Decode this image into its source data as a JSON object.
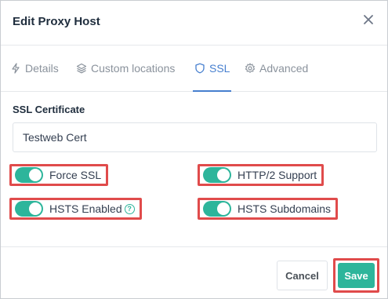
{
  "dialog": {
    "title": "Edit Proxy Host"
  },
  "tabs": [
    {
      "label": "Details",
      "icon": "lightning-icon",
      "active": false
    },
    {
      "label": "Custom locations",
      "icon": "layers-icon",
      "active": false
    },
    {
      "label": "SSL",
      "icon": "shield-icon",
      "active": true
    },
    {
      "label": "Advanced",
      "icon": "gear-icon",
      "active": false
    }
  ],
  "ssl": {
    "certificate_label": "SSL Certificate",
    "certificate_value": "Testweb Cert",
    "toggles": {
      "force_ssl": {
        "label": "Force SSL",
        "on": true
      },
      "http2": {
        "label": "HTTP/2 Support",
        "on": true
      },
      "hsts": {
        "label": "HSTS Enabled",
        "on": true,
        "help_icon": "question-circle-icon"
      },
      "hsts_subdomains": {
        "label": "HSTS Subdomains",
        "on": true
      }
    }
  },
  "footer": {
    "cancel_label": "Cancel",
    "save_label": "Save"
  },
  "colors": {
    "accent": "#2db59b",
    "tab_active": "#467fcf",
    "highlight": "#e04b4b"
  }
}
